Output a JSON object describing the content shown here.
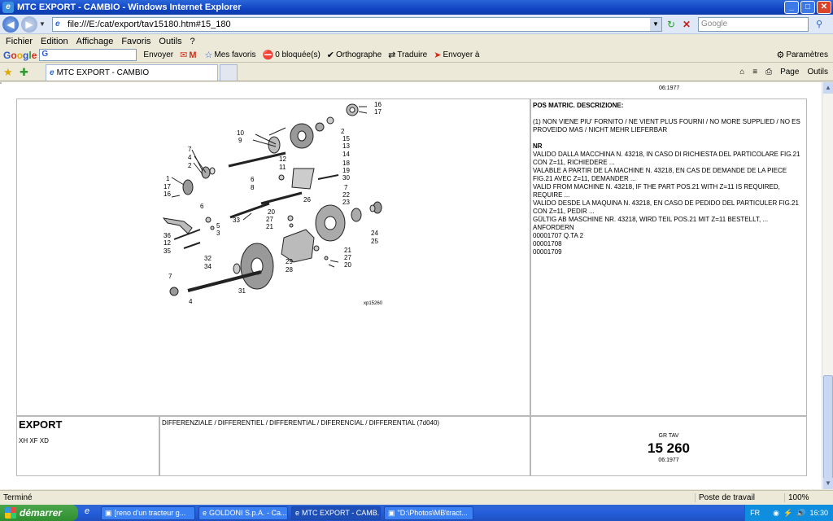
{
  "window": {
    "title": "MTC EXPORT - CAMBIO - Windows Internet Explorer"
  },
  "address": {
    "url": "file:///E:/cat/export/tav15180.htm#15_180",
    "search_placeholder": "Google"
  },
  "menu": [
    "Fichier",
    "Edition",
    "Affichage",
    "Favoris",
    "Outils",
    "?"
  ],
  "google_toolbar": {
    "send": "Envoyer",
    "favorites": "Mes favoris",
    "blocked": "0 bloquée(s)",
    "spell": "Orthographe",
    "translate": "Traduire",
    "send_to": "Envoyer à",
    "params": "Paramètres"
  },
  "tab": {
    "label": "MTC EXPORT - CAMBIO",
    "page": "Page",
    "tools": "Outils"
  },
  "content": {
    "top_date": "06:1977",
    "diagram_code": "xp15260",
    "part_numbers": [
      "16",
      "17",
      "2",
      "15",
      "13",
      "14",
      "10",
      "9",
      "7",
      "4",
      "2",
      "1",
      "17",
      "16",
      "6",
      "8",
      "12",
      "11",
      "18",
      "19",
      "30",
      "7",
      "22",
      "23",
      "26",
      "20",
      "27",
      "21",
      "24",
      "25",
      "36",
      "12",
      "35",
      "6",
      "5",
      "3",
      "33",
      "32",
      "34",
      "7",
      "4",
      "31",
      "29",
      "28",
      "21",
      "27",
      "20"
    ],
    "desc_header": "POS MATRIC. DESCRIZIONE:",
    "desc_p1": "(1) NON VIENE PIU' FORNITO / NE VIENT PLUS FOURNI / NO MORE SUPPLIED / NO ES PROVEIDO MAS / NICHT MEHR LIEFERBAR",
    "desc_nr": "NR",
    "desc_l1": "VALIDO DALLA MACCHINA N. 43218, IN CASO DI RICHIESTA DEL PARTICOLARE FIG.21 CON Z=11, RICHIEDERE ...",
    "desc_l2": "VALABLE A PARTIR DE LA MACHINE N. 43218, EN CAS DE DEMANDE DE LA PIECE FIG.21 AVEC Z=11, DEMANDER ...",
    "desc_l3": "VALID FROM MACHINE N. 43218, IF THE PART POS.21 WITH Z=11 IS REQUIRED, REQUIRE ...",
    "desc_l4": "VALIDO DESDE LA MAQUINA N. 43218, EN CASO DE PEDIDO DEL PARTICULER FIG.21 CON Z=11, PEDIR ...",
    "desc_l5": "GÜLTIG AB MASCHINE NR. 43218, WIRD TEIL POS.21 MIT Z=11 BESTELLT, ... ANFORDERN",
    "desc_l6": "00001707 Q.TA 2",
    "desc_l7": "00001708",
    "desc_l8": "00001709",
    "export_title": "EXPORT",
    "export_models": "XH XF XD",
    "section": "DIFFERENZIALE / DIFFERENTIEL / DIFFERENTIAL / DIFERENCIAL / DIFFERENTIAL (7d040)",
    "grtav": "GR TAV",
    "big_number": "15 260",
    "bottom_date": "06:1977"
  },
  "status": {
    "text": "Terminé",
    "zone": "Poste de travail",
    "zoom": "100%"
  },
  "taskbar": {
    "start": "démarrer",
    "items": [
      "[reno d'un tracteur g...",
      "GOLDONI S.p.A. - Ca...",
      "MTC EXPORT - CAMB...",
      "\"D:\\Photos\\MB\\tract..."
    ],
    "lang": "FR",
    "time": "16:30"
  }
}
